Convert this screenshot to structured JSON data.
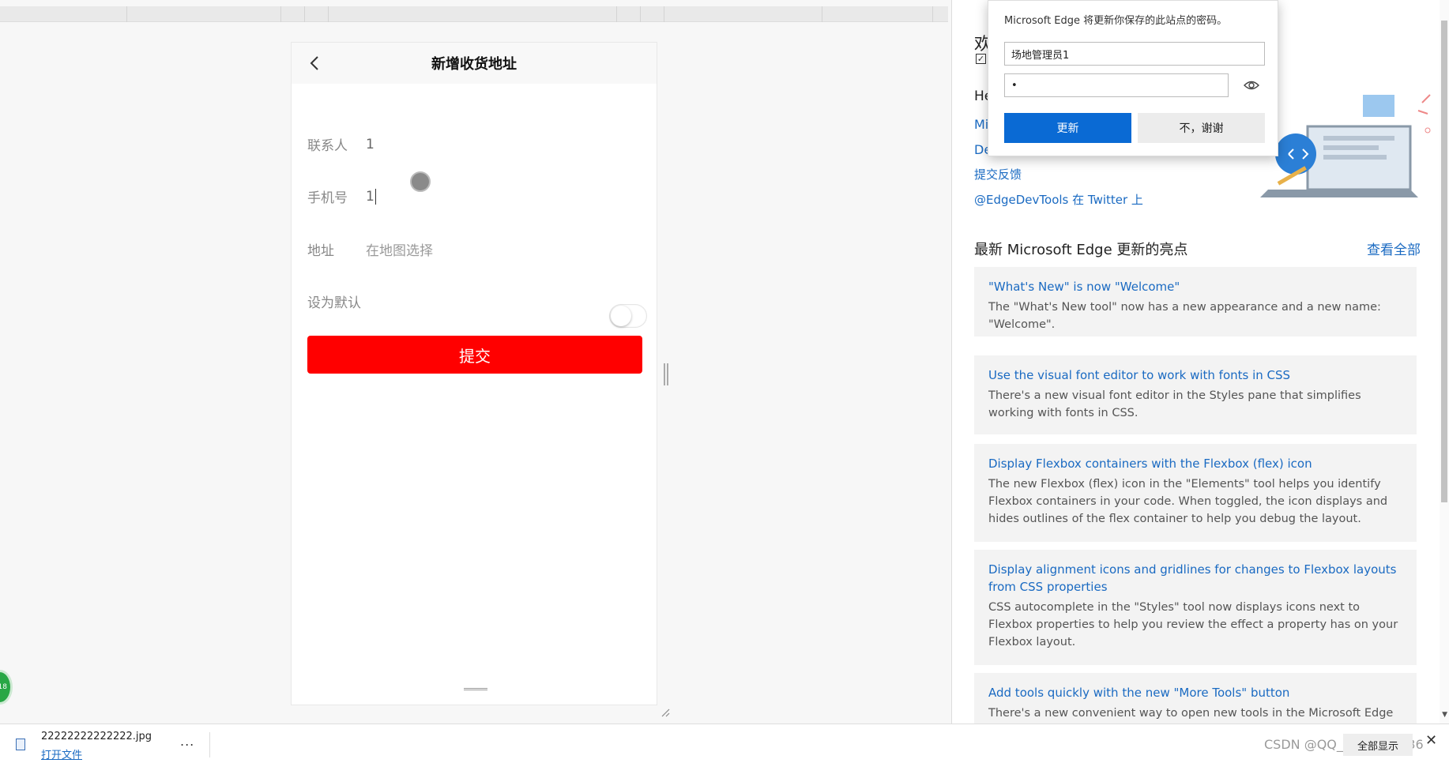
{
  "phone": {
    "title": "新增收货地址",
    "contact_label": "联系人",
    "contact_value": "1",
    "phone_label": "手机号",
    "phone_value": "1",
    "address_label": "地址",
    "address_placeholder": "在地图选择",
    "default_label": "设为默认",
    "default_enabled": false,
    "submit_label": "提交",
    "submit_color": "#ff0000"
  },
  "password_popup": {
    "message": "Microsoft Edge 将更新你保存的此站点的密码。",
    "username": "场地管理员1",
    "password_masked": "•",
    "update_label": "更新",
    "no_thanks_label": "不，谢谢",
    "accent": "#0a6ad4"
  },
  "devtools": {
    "heading_fragment": "欢",
    "help_fragment": "He",
    "link_mi_fragment": "Mi",
    "link_de_fragment": "De",
    "feedback_link": "提交反馈",
    "twitter_link": "@EdgeDevTools 在 Twitter 上",
    "section_title": "最新 Microsoft Edge 更新的亮点",
    "view_all": "查看全部",
    "link_color": "#1a6ac2",
    "cards": [
      {
        "title": "\"What's New\" is now \"Welcome\"",
        "body": "The \"What's New tool\" now has a new appearance and a new name: \"Welcome\"."
      },
      {
        "title": "Use the visual font editor to work with fonts in CSS",
        "body": "There's a new visual font editor in the Styles pane that simplifies working with fonts in CSS."
      },
      {
        "title": "Display Flexbox containers with the Flexbox (flex) icon",
        "body": "The new Flexbox (flex) icon in the \"Elements\" tool helps you identify Flexbox containers in your code. When toggled, the icon displays and hides outlines of the flex container to help you debug the layout."
      },
      {
        "title": "Display alignment icons and gridlines for changes to Flexbox layouts from CSS properties",
        "body": "CSS autocomplete in the \"Styles\" tool now displays icons next to Flexbox properties to help you review the effect a property has on your Flexbox layout."
      },
      {
        "title": "Add tools quickly with the new \"More Tools\" button",
        "body": "There's a new convenient way to open new tools in the Microsoft Edge"
      }
    ]
  },
  "badge": {
    "text": "18"
  },
  "download_bar": {
    "file_name": "22222222222222.jpg",
    "open_file": "打开文件",
    "more": "...",
    "show_all": "全部显示",
    "close": "✕",
    "watermark": "CSDN @QQ_3793049736"
  }
}
